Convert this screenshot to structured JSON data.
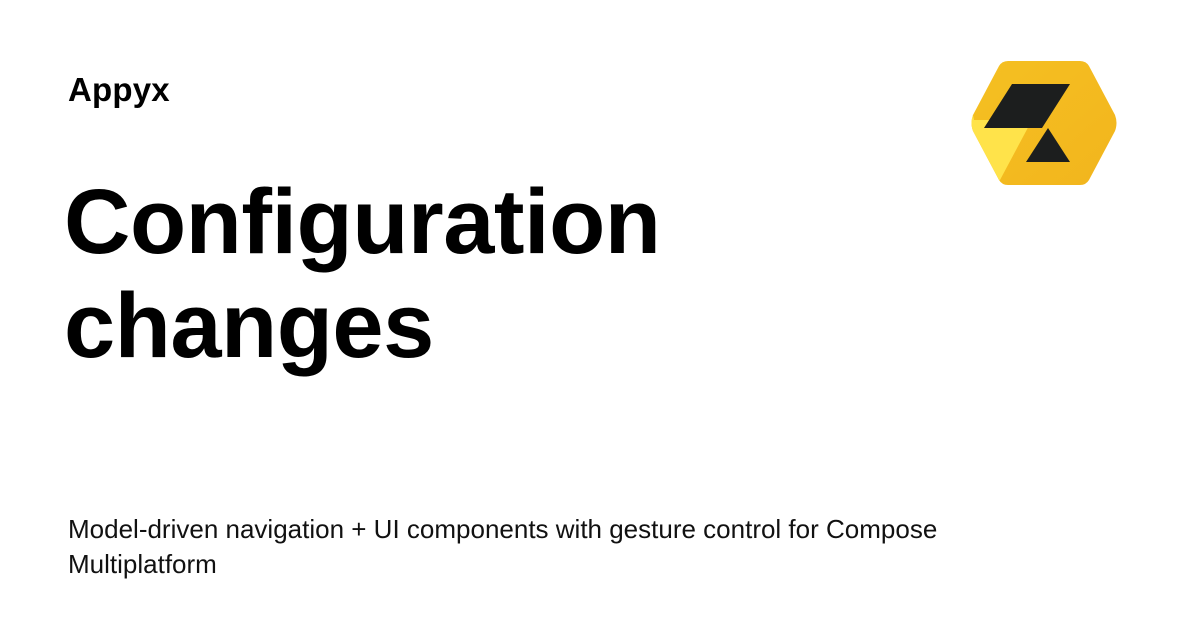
{
  "site": {
    "name": "Appyx"
  },
  "title": {
    "line1": "Configuration",
    "line2": "changes"
  },
  "description": "Model-driven navigation + UI components with gesture control for Compose Multiplatform",
  "logo": {
    "icon": "appyx-hexagon-logo-icon",
    "colors": {
      "yellow_dark": "#F5C022",
      "yellow_light": "#FFE34A",
      "black": "#1C1E1E"
    }
  }
}
